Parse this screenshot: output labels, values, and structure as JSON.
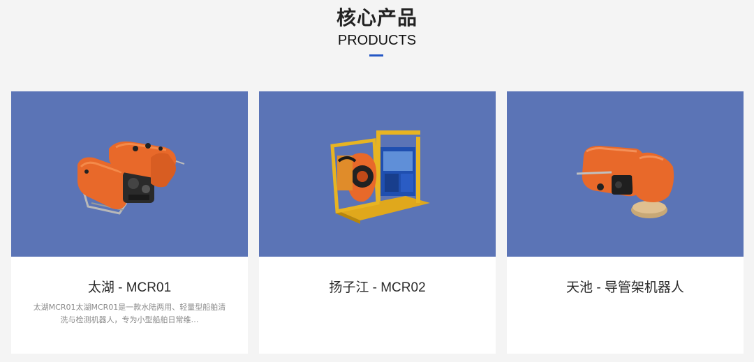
{
  "header": {
    "title_cn": "核心产品",
    "title_en": "PRODUCTS"
  },
  "colors": {
    "accent": "#2457c5",
    "card_image_bg": "#5b74b6",
    "product_orange": "#e8692a"
  },
  "products": [
    {
      "name": "太湖 - MCR01",
      "description": "太湖MCR01太湖MCR01是一款水陆两用、轻量型船舶清洗与检测机器人，专为小型船舶日常维…",
      "image_icon": "amphibious-cleaning-robot"
    },
    {
      "name": "扬子江 - MCR02",
      "description": "",
      "image_icon": "hydraulic-robot-with-frame"
    },
    {
      "name": "天池 - 导管架机器人",
      "description": "",
      "image_icon": "jacket-robot-with-brush"
    }
  ]
}
